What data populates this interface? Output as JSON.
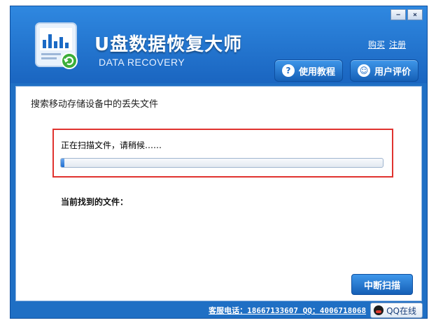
{
  "window": {
    "minimize_label": "−",
    "close_label": "×"
  },
  "header": {
    "title": "U盘数据恢复大师",
    "subtitle": "DATA RECOVERY",
    "links": {
      "buy": "购买",
      "register": "注册"
    },
    "tutorial_button": "使用教程",
    "review_button": "用户评价",
    "tutorial_icon_glyph": "?",
    "review_icon_glyph": "☺"
  },
  "main": {
    "heading": "搜索移动存储设备中的丢失文件",
    "scan_status": "正在扫描文件，请稍候……",
    "progress_percent": 1,
    "found_label": "当前找到的文件：",
    "stop_button": "中断扫描"
  },
  "footer": {
    "service_text": "客服电话：18667133607 QQ：4006718068",
    "qq_button": "QQ在线"
  },
  "colors": {
    "accent": "#1f6fc4",
    "highlight_border": "#e0332f"
  }
}
